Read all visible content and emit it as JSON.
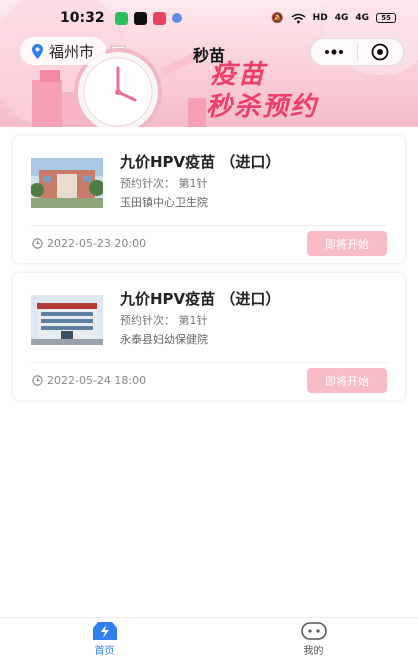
{
  "status_bar": {
    "time": "10:32",
    "signal_1": "4G",
    "signal_2": "4G",
    "hd_label": "HD",
    "battery": "55"
  },
  "nav": {
    "location": "福州市",
    "title": "秒苗"
  },
  "hero": {
    "headline_line1": "疫苗",
    "headline_line2": "秒杀预约"
  },
  "colors": {
    "accent_pink": "#ee3e6a",
    "button_pink": "#f7bcc6",
    "tab_active": "#2f80ed"
  },
  "cards": [
    {
      "title": "九价HPV疫苗 （进口）",
      "dose": "预约针次： 第1针",
      "hospital": "玉田镇中心卫生院",
      "time": "2022-05-23 20:00",
      "button": "即将开始",
      "clock_icon": "clock-icon"
    },
    {
      "title": "九价HPV疫苗 （进口）",
      "dose": "预约针次： 第1针",
      "hospital": "永泰县妇幼保健院",
      "time": "2022-05-24 18:00",
      "button": "即将开始",
      "clock_icon": "clock-icon"
    }
  ],
  "tabs": [
    {
      "label": "首页",
      "icon": "home-bolt-icon",
      "active": true
    },
    {
      "label": "我的",
      "icon": "profile-face-icon",
      "active": false
    }
  ]
}
